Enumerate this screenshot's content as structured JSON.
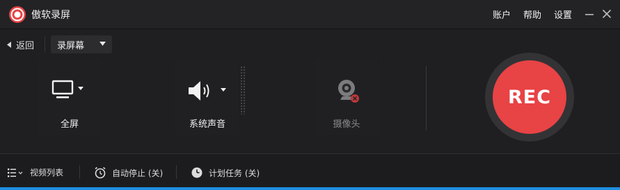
{
  "app": {
    "title": "傲软录屏",
    "menu": [
      "账户",
      "帮助",
      "设置"
    ]
  },
  "toolbar": {
    "back_label": "返回",
    "mode_value": "录屏幕"
  },
  "sources": {
    "screen": {
      "label": "全屏",
      "icon": "monitor-icon"
    },
    "audio": {
      "label": "系统声音",
      "icon": "speaker-icon"
    },
    "camera": {
      "label": "摄像头",
      "icon": "webcam-icon",
      "enabled": false
    }
  },
  "rec": {
    "label": "REC",
    "color": "#e84345"
  },
  "bottom": {
    "video_list": "视频列表",
    "auto_stop": "自动停止 (关)",
    "schedule": "计划任务 (关)"
  },
  "colors": {
    "accent": "#1e8fe0",
    "rec": "#e84345",
    "background": "#1f1f21"
  }
}
